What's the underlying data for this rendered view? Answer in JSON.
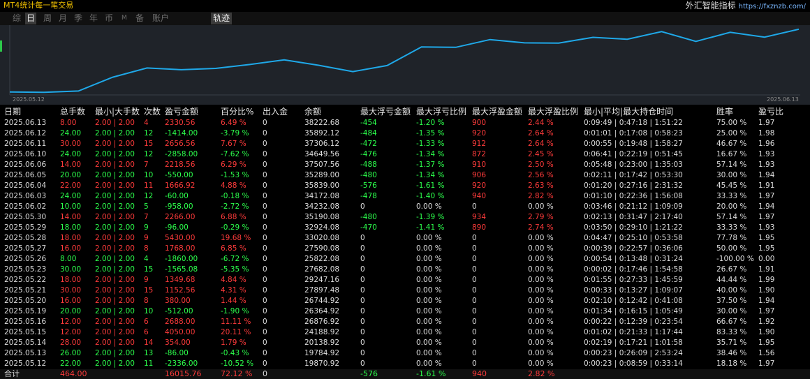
{
  "app": {
    "title": "MT4统计每一笔交易",
    "brand": "外汇智能指标",
    "brand_url": "https://fxznzb.com/"
  },
  "period_tabs": [
    {
      "label": "综",
      "active": false
    },
    {
      "label": "日",
      "active": true
    },
    {
      "label": "周",
      "active": false
    },
    {
      "label": "月",
      "active": false
    },
    {
      "label": "季",
      "active": false
    },
    {
      "label": "年",
      "active": false
    },
    {
      "label": "币",
      "active": false
    },
    {
      "label": "M",
      "active": false
    },
    {
      "label": "备",
      "active": false
    },
    {
      "label": "账户",
      "active": false
    }
  ],
  "trace_button": "轨迹",
  "chart_data": {
    "type": "line",
    "x_start_label": "2025.05.12",
    "x_end_label": "2025.06.13",
    "line_color": "#1fa8e8",
    "x": [
      "2025.05.12",
      "2025.05.13",
      "2025.05.14",
      "2025.05.15",
      "2025.05.16",
      "2025.05.19",
      "2025.05.20",
      "2025.05.21",
      "2025.05.22",
      "2025.05.23",
      "2025.05.26",
      "2025.05.27",
      "2025.05.28",
      "2025.05.29",
      "2025.05.30",
      "2025.06.02",
      "2025.06.03",
      "2025.06.04",
      "2025.06.05",
      "2025.06.06",
      "2025.06.10",
      "2025.06.11",
      "2025.06.12",
      "2025.06.13"
    ],
    "values": [
      19870.92,
      19784.92,
      20138.92,
      24188.92,
      26876.92,
      26364.92,
      26744.92,
      27897.48,
      29247.16,
      27682.08,
      25822.08,
      27590.08,
      33020.08,
      32924.08,
      35190.08,
      34232.08,
      34172.08,
      35839.0,
      35289.0,
      37507.56,
      34649.56,
      37306.12,
      35892.12,
      38222.68
    ],
    "ylim": [
      19000,
      39000
    ]
  },
  "columns": [
    "日期",
    "总手数",
    "最小|大手数",
    "次数",
    "盈亏金额",
    "百分比%",
    "出入金",
    "余额",
    "最大浮亏金额",
    "最大浮亏比例",
    "最大浮盈金额",
    "最大浮盈比例",
    "最小|平均|最大持仓时间",
    "胜率",
    "盈亏比"
  ],
  "colors": {
    "profit": "#ff3b3b",
    "loss": "#2cff4c",
    "neutral": "#dcdcdc"
  },
  "rows": [
    {
      "date": "2025.06.13",
      "lots": "8.00",
      "minmax": "2.00 | 2.00",
      "count": "4",
      "pnl": "2330.56",
      "pct": "6.49 %",
      "dep": "0",
      "bal": "38222.68",
      "mfl": "-454",
      "mflp": "-1.20 %",
      "mfp": "900",
      "mfpp": "2.44 %",
      "hold": "0:09:49 | 0:47:18 | 1:51:22",
      "win": "75.00 %",
      "pr": "1.97",
      "pos": true
    },
    {
      "date": "2025.06.12",
      "lots": "24.00",
      "minmax": "2.00 | 2.00",
      "count": "12",
      "pnl": "-1414.00",
      "pct": "-3.79 %",
      "dep": "0",
      "bal": "35892.12",
      "mfl": "-484",
      "mflp": "-1.35 %",
      "mfp": "920",
      "mfpp": "2.64 %",
      "hold": "0:01:01 | 0:17:08 | 0:58:23",
      "win": "25.00 %",
      "pr": "1.98",
      "pos": false
    },
    {
      "date": "2025.06.11",
      "lots": "30.00",
      "minmax": "2.00 | 2.00",
      "count": "15",
      "pnl": "2656.56",
      "pct": "7.67 %",
      "dep": "0",
      "bal": "37306.12",
      "mfl": "-472",
      "mflp": "-1.33 %",
      "mfp": "912",
      "mfpp": "2.64 %",
      "hold": "0:00:55 | 0:19:48 | 1:58:27",
      "win": "46.67 %",
      "pr": "1.96",
      "pos": true
    },
    {
      "date": "2025.06.10",
      "lots": "24.00",
      "minmax": "2.00 | 2.00",
      "count": "12",
      "pnl": "-2858.00",
      "pct": "-7.62 %",
      "dep": "0",
      "bal": "34649.56",
      "mfl": "-476",
      "mflp": "-1.34 %",
      "mfp": "872",
      "mfpp": "2.45 %",
      "hold": "0:06:41 | 0:22:19 | 0:51:45",
      "win": "16.67 %",
      "pr": "1.93",
      "pos": false
    },
    {
      "date": "2025.06.06",
      "lots": "14.00",
      "minmax": "2.00 | 2.00",
      "count": "7",
      "pnl": "2218.56",
      "pct": "6.29 %",
      "dep": "0",
      "bal": "37507.56",
      "mfl": "-488",
      "mflp": "-1.37 %",
      "mfp": "910",
      "mfpp": "2.50 %",
      "hold": "0:05:48 | 0:23:00 | 1:35:03",
      "win": "57.14 %",
      "pr": "1.93",
      "pos": true
    },
    {
      "date": "2025.06.05",
      "lots": "20.00",
      "minmax": "2.00 | 2.00",
      "count": "10",
      "pnl": "-550.00",
      "pct": "-1.53 %",
      "dep": "0",
      "bal": "35289.00",
      "mfl": "-480",
      "mflp": "-1.34 %",
      "mfp": "906",
      "mfpp": "2.56 %",
      "hold": "0:02:11 | 0:17:42 | 0:53:30",
      "win": "30.00 %",
      "pr": "1.94",
      "pos": false
    },
    {
      "date": "2025.06.04",
      "lots": "22.00",
      "minmax": "2.00 | 2.00",
      "count": "11",
      "pnl": "1666.92",
      "pct": "4.88 %",
      "dep": "0",
      "bal": "35839.00",
      "mfl": "-576",
      "mflp": "-1.61 %",
      "mfp": "920",
      "mfpp": "2.63 %",
      "hold": "0:01:20 | 0:27:16 | 2:31:32",
      "win": "45.45 %",
      "pr": "1.91",
      "pos": true
    },
    {
      "date": "2025.06.03",
      "lots": "24.00",
      "minmax": "2.00 | 2.00",
      "count": "12",
      "pnl": "-60.00",
      "pct": "-0.18 %",
      "dep": "0",
      "bal": "34172.08",
      "mfl": "-478",
      "mflp": "-1.40 %",
      "mfp": "940",
      "mfpp": "2.82 %",
      "hold": "0:01:10 | 0:22:36 | 1:56:08",
      "win": "33.33 %",
      "pr": "1.97",
      "pos": false
    },
    {
      "date": "2025.06.02",
      "lots": "10.00",
      "minmax": "2.00 | 2.00",
      "count": "5",
      "pnl": "-958.00",
      "pct": "-2.72 %",
      "dep": "0",
      "bal": "34232.08",
      "mfl": "0",
      "mflp": "0.00 %",
      "mfp": "0",
      "mfpp": "0.00 %",
      "hold": "0:03:46 | 0:21:12 | 1:09:09",
      "win": "20.00 %",
      "pr": "1.94",
      "pos": false
    },
    {
      "date": "2025.05.30",
      "lots": "14.00",
      "minmax": "2.00 | 2.00",
      "count": "7",
      "pnl": "2266.00",
      "pct": "6.88 %",
      "dep": "0",
      "bal": "35190.08",
      "mfl": "-480",
      "mflp": "-1.39 %",
      "mfp": "934",
      "mfpp": "2.79 %",
      "hold": "0:02:13 | 0:31:47 | 2:17:40",
      "win": "57.14 %",
      "pr": "1.97",
      "pos": true
    },
    {
      "date": "2025.05.29",
      "lots": "18.00",
      "minmax": "2.00 | 2.00",
      "count": "9",
      "pnl": "-96.00",
      "pct": "-0.29 %",
      "dep": "0",
      "bal": "32924.08",
      "mfl": "-470",
      "mflp": "-1.41 %",
      "mfp": "890",
      "mfpp": "2.74 %",
      "hold": "0:03:50 | 0:29:10 | 1:21:22",
      "win": "33.33 %",
      "pr": "1.93",
      "pos": false
    },
    {
      "date": "2025.05.28",
      "lots": "18.00",
      "minmax": "2.00 | 2.00",
      "count": "9",
      "pnl": "5430.00",
      "pct": "19.68 %",
      "dep": "0",
      "bal": "33020.08",
      "mfl": "0",
      "mflp": "0.00 %",
      "mfp": "0",
      "mfpp": "0.00 %",
      "hold": "0:04:47 | 0:25:10 | 0:53:58",
      "win": "77.78 %",
      "pr": "1.95",
      "pos": true
    },
    {
      "date": "2025.05.27",
      "lots": "16.00",
      "minmax": "2.00 | 2.00",
      "count": "8",
      "pnl": "1768.00",
      "pct": "6.85 %",
      "dep": "0",
      "bal": "27590.08",
      "mfl": "0",
      "mflp": "0.00 %",
      "mfp": "0",
      "mfpp": "0.00 %",
      "hold": "0:00:39 | 0:22:57 | 0:36:06",
      "win": "50.00 %",
      "pr": "1.95",
      "pos": true
    },
    {
      "date": "2025.05.26",
      "lots": "8.00",
      "minmax": "2.00 | 2.00",
      "count": "4",
      "pnl": "-1860.00",
      "pct": "-6.72 %",
      "dep": "0",
      "bal": "25822.08",
      "mfl": "0",
      "mflp": "0.00 %",
      "mfp": "0",
      "mfpp": "0.00 %",
      "hold": "0:00:54 | 0:13:48 | 0:31:24",
      "win": "-100.00 %",
      "pr": "0.00",
      "pos": false
    },
    {
      "date": "2025.05.23",
      "lots": "30.00",
      "minmax": "2.00 | 2.00",
      "count": "15",
      "pnl": "-1565.08",
      "pct": "-5.35 %",
      "dep": "0",
      "bal": "27682.08",
      "mfl": "0",
      "mflp": "0.00 %",
      "mfp": "0",
      "mfpp": "0.00 %",
      "hold": "0:00:02 | 0:17:46 | 1:54:58",
      "win": "26.67 %",
      "pr": "1.91",
      "pos": false
    },
    {
      "date": "2025.05.22",
      "lots": "18.00",
      "minmax": "2.00 | 2.00",
      "count": "9",
      "pnl": "1349.68",
      "pct": "4.84 %",
      "dep": "0",
      "bal": "29247.16",
      "mfl": "0",
      "mflp": "0.00 %",
      "mfp": "0",
      "mfpp": "0.00 %",
      "hold": "0:01:55 | 0:27:33 | 1:45:59",
      "win": "44.44 %",
      "pr": "1.99",
      "pos": true
    },
    {
      "date": "2025.05.21",
      "lots": "30.00",
      "minmax": "2.00 | 2.00",
      "count": "15",
      "pnl": "1152.56",
      "pct": "4.31 %",
      "dep": "0",
      "bal": "27897.48",
      "mfl": "0",
      "mflp": "0.00 %",
      "mfp": "0",
      "mfpp": "0.00 %",
      "hold": "0:00:33 | 0:13:27 | 1:09:07",
      "win": "40.00 %",
      "pr": "1.90",
      "pos": true
    },
    {
      "date": "2025.05.20",
      "lots": "16.00",
      "minmax": "2.00 | 2.00",
      "count": "8",
      "pnl": "380.00",
      "pct": "1.44 %",
      "dep": "0",
      "bal": "26744.92",
      "mfl": "0",
      "mflp": "0.00 %",
      "mfp": "0",
      "mfpp": "0.00 %",
      "hold": "0:02:10 | 0:12:42 | 0:41:08",
      "win": "37.50 %",
      "pr": "1.94",
      "pos": true
    },
    {
      "date": "2025.05.19",
      "lots": "20.00",
      "minmax": "2.00 | 2.00",
      "count": "10",
      "pnl": "-512.00",
      "pct": "-1.90 %",
      "dep": "0",
      "bal": "26364.92",
      "mfl": "0",
      "mflp": "0.00 %",
      "mfp": "0",
      "mfpp": "0.00 %",
      "hold": "0:01:34 | 0:16:15 | 1:05:49",
      "win": "30.00 %",
      "pr": "1.97",
      "pos": false
    },
    {
      "date": "2025.05.16",
      "lots": "12.00",
      "minmax": "2.00 | 2.00",
      "count": "6",
      "pnl": "2688.00",
      "pct": "11.11 %",
      "dep": "0",
      "bal": "26876.92",
      "mfl": "0",
      "mflp": "0.00 %",
      "mfp": "0",
      "mfpp": "0.00 %",
      "hold": "0:00:22 | 0:12:39 | 0:23:54",
      "win": "66.67 %",
      "pr": "1.92",
      "pos": true
    },
    {
      "date": "2025.05.15",
      "lots": "12.00",
      "minmax": "2.00 | 2.00",
      "count": "6",
      "pnl": "4050.00",
      "pct": "20.11 %",
      "dep": "0",
      "bal": "24188.92",
      "mfl": "0",
      "mflp": "0.00 %",
      "mfp": "0",
      "mfpp": "0.00 %",
      "hold": "0:01:02 | 0:21:33 | 1:17:44",
      "win": "83.33 %",
      "pr": "1.90",
      "pos": true
    },
    {
      "date": "2025.05.14",
      "lots": "28.00",
      "minmax": "2.00 | 2.00",
      "count": "14",
      "pnl": "354.00",
      "pct": "1.79 %",
      "dep": "0",
      "bal": "20138.92",
      "mfl": "0",
      "mflp": "0.00 %",
      "mfp": "0",
      "mfpp": "0.00 %",
      "hold": "0:02:19 | 0:17:21 | 1:01:58",
      "win": "35.71 %",
      "pr": "1.95",
      "pos": true
    },
    {
      "date": "2025.05.13",
      "lots": "26.00",
      "minmax": "2.00 | 2.00",
      "count": "13",
      "pnl": "-86.00",
      "pct": "-0.43 %",
      "dep": "0",
      "bal": "19784.92",
      "mfl": "0",
      "mflp": "0.00 %",
      "mfp": "0",
      "mfpp": "0.00 %",
      "hold": "0:00:23 | 0:26:09 | 2:53:24",
      "win": "38.46 %",
      "pr": "1.56",
      "pos": false
    },
    {
      "date": "2025.05.12",
      "lots": "22.00",
      "minmax": "2.00 | 2.00",
      "count": "11",
      "pnl": "-2336.00",
      "pct": "-10.52 %",
      "dep": "0",
      "bal": "19870.92",
      "mfl": "0",
      "mflp": "0.00 %",
      "mfp": "0",
      "mfpp": "0.00 %",
      "hold": "0:00:23 | 0:08:59 | 0:33:14",
      "win": "18.18 %",
      "pr": "1.97",
      "pos": false
    }
  ],
  "total": {
    "label": "合计",
    "lots": "464.00",
    "pnl": "16015.76",
    "pct": "72.12 %",
    "dep": "0",
    "mfl": "-576",
    "mflp": "-1.61 %",
    "mfp": "940",
    "mfpp": "2.82 %"
  }
}
